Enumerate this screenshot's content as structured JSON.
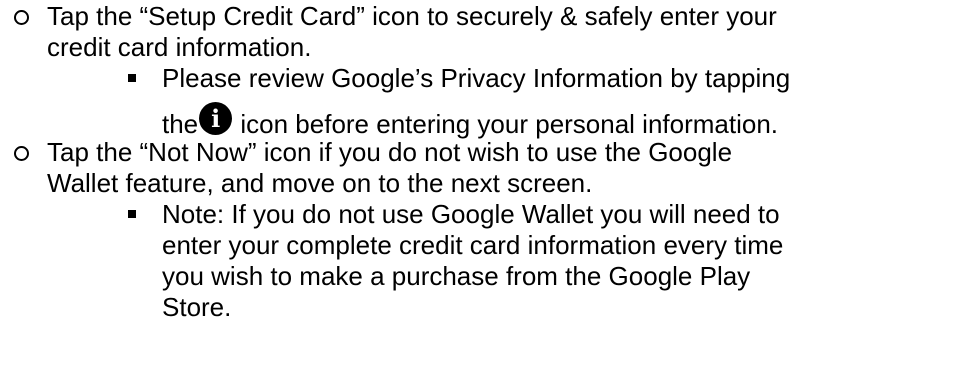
{
  "items": [
    {
      "lines": [
        "Tap the “Setup Credit Card” icon to securely & safely enter your",
        "credit card information."
      ],
      "subitems": [
        {
          "line1": "Please review Google’s Privacy Information by tapping",
          "line2_before": "the",
          "icon": "info-icon",
          "icon_glyph": "i",
          "line2_after": " icon before entering your personal information."
        }
      ]
    },
    {
      "lines": [
        "Tap the “Not Now” icon if you do not wish to use the Google",
        "Wallet feature, and move on to the next screen."
      ],
      "subitems": [
        {
          "lines": [
            "Note: If you do not use Google Wallet you will need to",
            "enter your complete credit card information every time",
            "you wish to make a purchase from the Google Play",
            "Store."
          ]
        }
      ]
    }
  ]
}
